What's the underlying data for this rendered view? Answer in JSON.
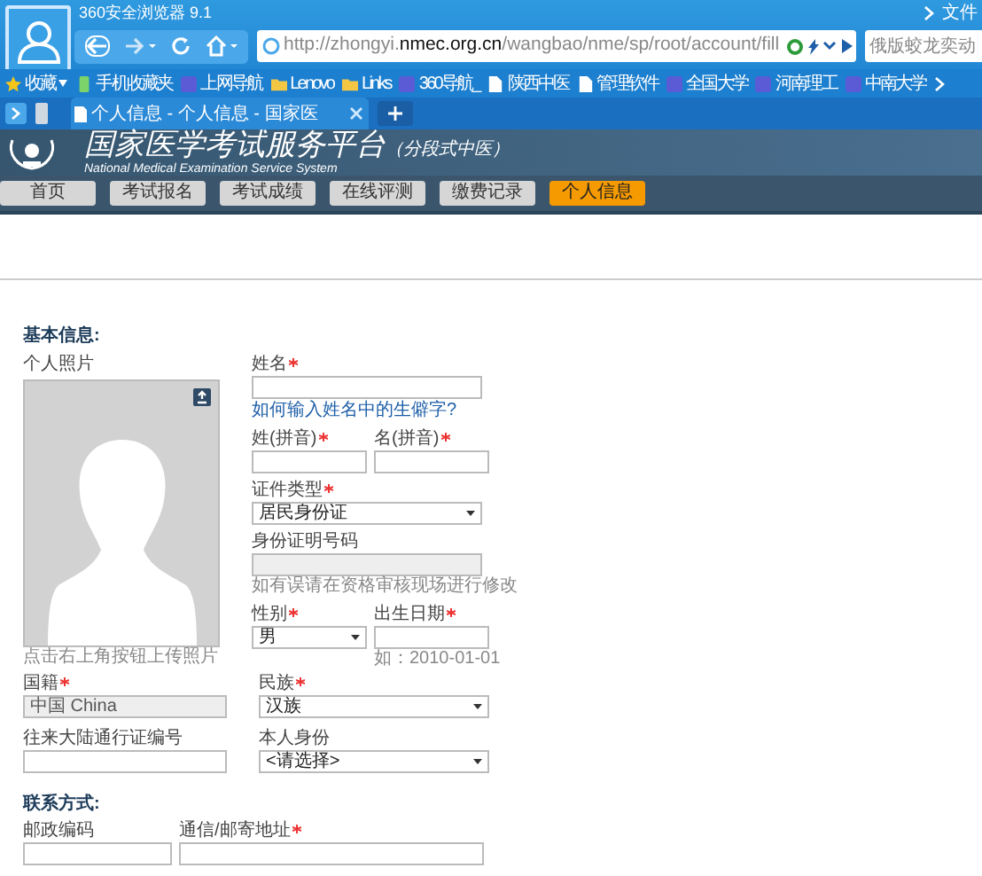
{
  "browser": {
    "title": "360安全浏览器 9.1",
    "menu": "文件",
    "url": "http://zhongyi.**nmec.org.cn**/wangbao/nme/sp/root/account/fill",
    "search_placeholder": "俄版蛟龙奕动"
  },
  "bookmarks": [
    {
      "label": "收藏",
      "kind": "star"
    },
    {
      "label": "手机收藏夹",
      "kind": "phone"
    },
    {
      "label": "上网导航",
      "kind": "site"
    },
    {
      "label": "Lenovo",
      "kind": "folder"
    },
    {
      "label": "Links",
      "kind": "folder"
    },
    {
      "label": "360导航_",
      "kind": "site"
    },
    {
      "label": "陕西中医",
      "kind": "page"
    },
    {
      "label": "管理软件",
      "kind": "page"
    },
    {
      "label": "全国大学",
      "kind": "site"
    },
    {
      "label": "河南理工",
      "kind": "site"
    },
    {
      "label": "中南大学",
      "kind": "site"
    }
  ],
  "tabs": [
    {
      "label": "个人信息 - 个人信息 - 国家医",
      "selected": true
    }
  ],
  "site": {
    "title": "国家医学考试服务平台",
    "subtitle": "（分段式中医）",
    "english": "National Medical Examination Service System"
  },
  "nav": [
    {
      "label": "首页",
      "selected": false
    },
    {
      "label": "考试报名",
      "selected": false
    },
    {
      "label": "考试成绩",
      "selected": false
    },
    {
      "label": "在线评测",
      "selected": false
    },
    {
      "label": "缴费记录",
      "selected": false
    },
    {
      "label": "个人信息",
      "selected": true
    }
  ],
  "sections": [
    {
      "title": "基本信息:",
      "photo": {
        "label": "个人照片",
        "caption": "点击右上角按钮上传照片"
      },
      "rows": [
        [
          {
            "label": "姓名",
            "required": true,
            "kind": "text",
            "link": "如何输入姓名中的生僻字?"
          }
        ],
        [
          {
            "label": "姓(拼音)",
            "required": true,
            "kind": "text"
          },
          {
            "label": "名(拼音)",
            "required": true,
            "kind": "text"
          }
        ],
        [
          {
            "label": "证件类型",
            "required": true,
            "kind": "select",
            "value": "居民身份证"
          }
        ],
        [
          {
            "label": "身份证明号码",
            "required": false,
            "kind": "text",
            "disabled": true,
            "hint": "如有误请在资格审核现场进行修改"
          }
        ],
        [
          {
            "label": "性别",
            "required": true,
            "kind": "select",
            "value": "男"
          },
          {
            "label": "出生日期",
            "required": true,
            "kind": "text",
            "hint": "如：2010-01-01"
          }
        ],
        [
          {
            "label": "国籍",
            "required": true,
            "kind": "text",
            "disabled": true,
            "value": "中国 China"
          },
          {
            "label": "民族",
            "required": true,
            "kind": "select",
            "value": "汉族"
          }
        ],
        [
          {
            "label": "往来大陆通行证编号",
            "required": false,
            "kind": "text"
          },
          {
            "label": "本人身份",
            "required": false,
            "kind": "select",
            "value": "<请选择>"
          }
        ]
      ]
    },
    {
      "title": "联系方式:",
      "rows": [
        [
          {
            "label": "邮政编码",
            "required": false,
            "kind": "text"
          },
          {
            "label": "通信/邮寄地址",
            "required": true,
            "kind": "text"
          }
        ]
      ]
    }
  ]
}
